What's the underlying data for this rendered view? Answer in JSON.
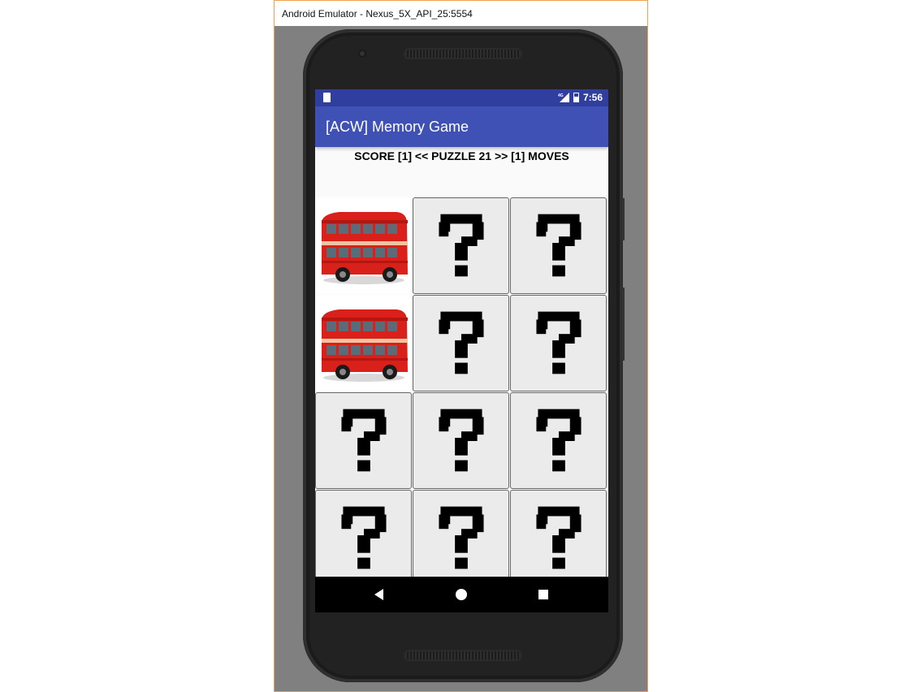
{
  "window": {
    "title": "Android Emulator - Nexus_5X_API_25:5554"
  },
  "status_bar": {
    "time": "7:56",
    "network": "4G",
    "left_icon": "sd-card-icon"
  },
  "app_bar": {
    "title": "[ACW] Memory Game"
  },
  "game": {
    "score_line": "SCORE [1] << PUZZLE 21 >> [1] MOVES",
    "cards": [
      {
        "state": "revealed",
        "image": "red-double-decker-bus"
      },
      {
        "state": "hidden"
      },
      {
        "state": "hidden"
      },
      {
        "state": "revealed",
        "image": "red-double-decker-bus"
      },
      {
        "state": "hidden"
      },
      {
        "state": "hidden"
      },
      {
        "state": "hidden"
      },
      {
        "state": "hidden"
      },
      {
        "state": "hidden"
      },
      {
        "state": "hidden"
      },
      {
        "state": "hidden"
      },
      {
        "state": "hidden"
      }
    ]
  },
  "nav_bar": {
    "buttons": [
      "back-icon",
      "home-icon",
      "recents-icon"
    ]
  },
  "colors": {
    "status_bar": "#303f9f",
    "app_bar": "#3f51b5",
    "bus_red": "#d9201a"
  }
}
